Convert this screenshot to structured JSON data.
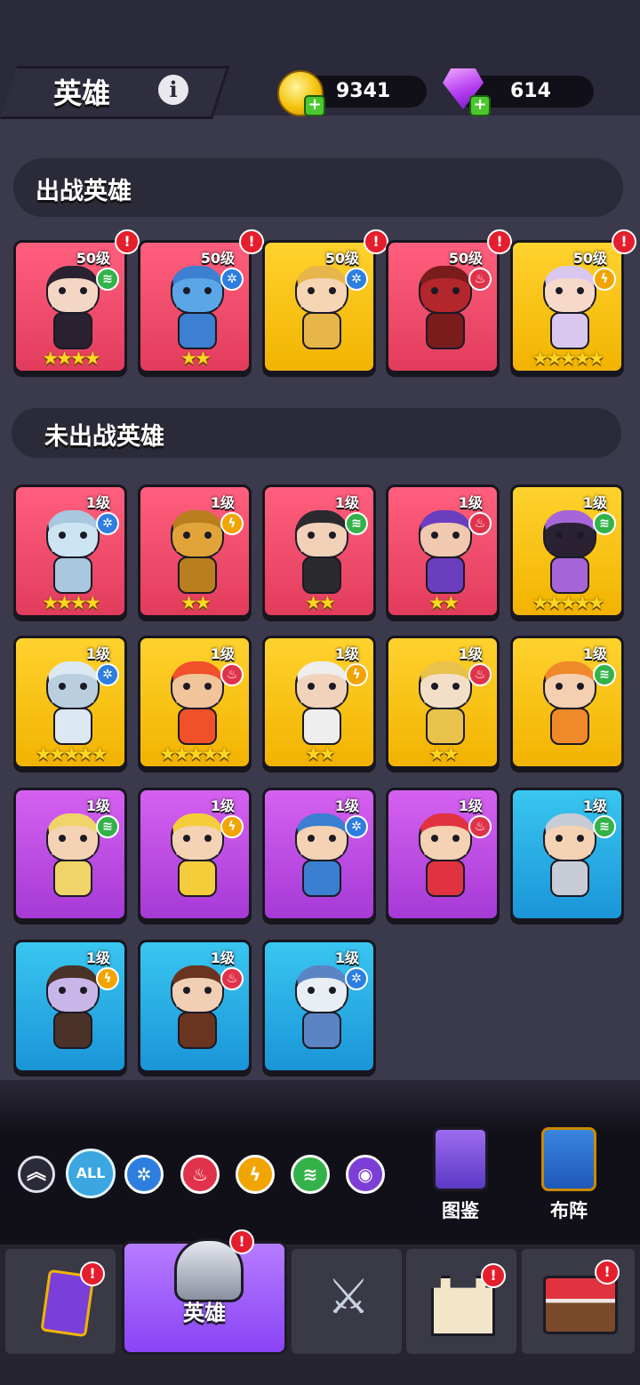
{
  "header": {
    "title": "英雄",
    "gold": "9341",
    "gems": "614"
  },
  "sections": {
    "deployed": "出战英雄",
    "undeployed": "未出战英雄"
  },
  "deployed_heroes": [
    {
      "level": "50级",
      "element": "wind",
      "stars": "★★★★",
      "color": "red",
      "skin": "#f3d6c4",
      "hair": "#2a2230"
    },
    {
      "level": "50级",
      "element": "ice",
      "stars": "★★",
      "color": "red",
      "skin": "#5aa6e6",
      "hair": "#3d7fd0"
    },
    {
      "level": "50级",
      "element": "ice",
      "stars": "",
      "color": "yellow",
      "skin": "#f6d5b5",
      "hair": "#e7b64a"
    },
    {
      "level": "50级",
      "element": "fire",
      "stars": "",
      "color": "red",
      "skin": "#b3262c",
      "hair": "#7a1c1c"
    },
    {
      "level": "50级",
      "element": "bolt",
      "stars": "★★★★★",
      "color": "yellow",
      "skin": "#f6d9c8",
      "hair": "#d9c7f0"
    }
  ],
  "undeployed_heroes": [
    {
      "level": "1级",
      "element": "ice",
      "stars": "★★★★",
      "color": "red",
      "skin": "#cde4f2",
      "hair": "#a9c7de"
    },
    {
      "level": "1级",
      "element": "bolt",
      "stars": "★★",
      "color": "red",
      "skin": "#e0a43a",
      "hair": "#b97f1e"
    },
    {
      "level": "1级",
      "element": "wind",
      "stars": "★★",
      "color": "red",
      "skin": "#f1d0b8",
      "hair": "#2b2a2f"
    },
    {
      "level": "1级",
      "element": "fire",
      "stars": "★★",
      "color": "red",
      "skin": "#f0c9b0",
      "hair": "#6b3ec0"
    },
    {
      "level": "1级",
      "element": "wind",
      "stars": "★★★★★",
      "color": "yellow",
      "skin": "#2a2233",
      "hair": "#a666d8"
    },
    {
      "level": "1级",
      "element": "ice",
      "stars": "★★★★★",
      "color": "yellow",
      "skin": "#b9cfe0",
      "hair": "#dce8f2"
    },
    {
      "level": "1级",
      "element": "fire",
      "stars": "★★★★★",
      "color": "yellow",
      "skin": "#f2c49a",
      "hair": "#f0502a"
    },
    {
      "level": "1级",
      "element": "bolt",
      "stars": "★★",
      "color": "yellow",
      "skin": "#f1d3bb",
      "hair": "#eeeeee"
    },
    {
      "level": "1级",
      "element": "fire",
      "stars": "★★",
      "color": "yellow",
      "skin": "#f3dfc8",
      "hair": "#e8c24a"
    },
    {
      "level": "1级",
      "element": "wind",
      "stars": "",
      "color": "yellow",
      "skin": "#f4cfb0",
      "hair": "#f0892a"
    },
    {
      "level": "1级",
      "element": "wind",
      "stars": "",
      "color": "purple",
      "skin": "#f4d2b4",
      "hair": "#f0d46a"
    },
    {
      "level": "1级",
      "element": "bolt",
      "stars": "",
      "color": "purple",
      "skin": "#f4d2b4",
      "hair": "#f5cc3a"
    },
    {
      "level": "1级",
      "element": "ice",
      "stars": "",
      "color": "purple",
      "skin": "#f4d2b4",
      "hair": "#3a7fd0"
    },
    {
      "level": "1级",
      "element": "fire",
      "stars": "",
      "color": "purple",
      "skin": "#f4d2b4",
      "hair": "#e0333f"
    },
    {
      "level": "1级",
      "element": "wind",
      "stars": "",
      "color": "blue",
      "skin": "#f4d2b4",
      "hair": "#c7ccd6"
    },
    {
      "level": "1级",
      "element": "bolt",
      "stars": "",
      "color": "blue",
      "skin": "#c9b6e8",
      "hair": "#4a3228"
    },
    {
      "level": "1级",
      "element": "fire",
      "stars": "",
      "color": "blue",
      "skin": "#f1cfb4",
      "hair": "#6a3420"
    },
    {
      "level": "1级",
      "element": "ice",
      "stars": "",
      "color": "blue",
      "skin": "#e8eef4",
      "hair": "#5b84c4"
    }
  ],
  "filters": [
    "ALL"
  ],
  "actions": {
    "codex": "图鉴",
    "formation": "布阵"
  },
  "nav": {
    "heroes": "英雄"
  }
}
